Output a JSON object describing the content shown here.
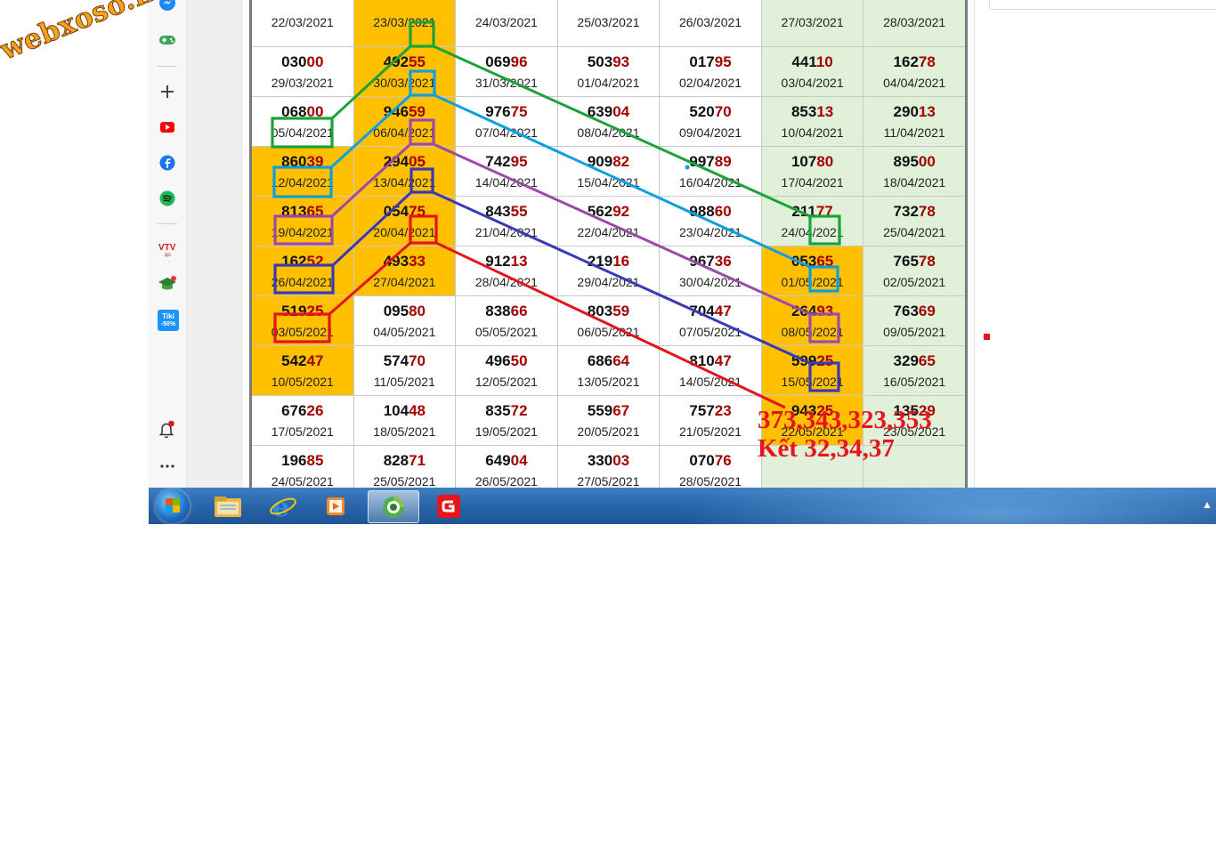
{
  "watermark": "webxoso.net",
  "results": {
    "rows": [
      {
        "cells": [
          {
            "num": "",
            "date": "22/03/2021"
          },
          {
            "num": "",
            "date": "23/03/2021"
          },
          {
            "num": "",
            "date": "24/03/2021"
          },
          {
            "num": "",
            "date": "25/03/2021"
          },
          {
            "num": "",
            "date": "26/03/2021"
          },
          {
            "num": "",
            "date": "27/03/2021"
          },
          {
            "num": "",
            "date": "28/03/2021"
          }
        ]
      },
      {
        "cells": [
          {
            "num": "03000",
            "date": "29/03/2021"
          },
          {
            "num": "49255",
            "date": "30/03/2021"
          },
          {
            "num": "06996",
            "date": "31/03/2021"
          },
          {
            "num": "50393",
            "date": "01/04/2021"
          },
          {
            "num": "01795",
            "date": "02/04/2021"
          },
          {
            "num": "44110",
            "date": "03/04/2021"
          },
          {
            "num": "16278",
            "date": "04/04/2021"
          }
        ]
      },
      {
        "cells": [
          {
            "num": "06800",
            "date": "05/04/2021"
          },
          {
            "num": "94659",
            "date": "06/04/2021"
          },
          {
            "num": "97675",
            "date": "07/04/2021"
          },
          {
            "num": "63904",
            "date": "08/04/2021"
          },
          {
            "num": "52070",
            "date": "09/04/2021"
          },
          {
            "num": "85313",
            "date": "10/04/2021"
          },
          {
            "num": "29013",
            "date": "11/04/2021"
          }
        ]
      },
      {
        "cells": [
          {
            "num": "86039",
            "date": "12/04/2021"
          },
          {
            "num": "29405",
            "date": "13/04/2021"
          },
          {
            "num": "74295",
            "date": "14/04/2021"
          },
          {
            "num": "90982",
            "date": "15/04/2021"
          },
          {
            "num": "99789",
            "date": "16/04/2021"
          },
          {
            "num": "10780",
            "date": "17/04/2021"
          },
          {
            "num": "89500",
            "date": "18/04/2021"
          }
        ]
      },
      {
        "cells": [
          {
            "num": "81365",
            "date": "19/04/2021"
          },
          {
            "num": "05475",
            "date": "20/04/2021"
          },
          {
            "num": "84355",
            "date": "21/04/2021"
          },
          {
            "num": "56292",
            "date": "22/04/2021"
          },
          {
            "num": "98860",
            "date": "23/04/2021"
          },
          {
            "num": "21177",
            "date": "24/04/2021"
          },
          {
            "num": "73278",
            "date": "25/04/2021"
          }
        ]
      },
      {
        "cells": [
          {
            "num": "16252",
            "date": "26/04/2021"
          },
          {
            "num": "49333",
            "date": "27/04/2021"
          },
          {
            "num": "91213",
            "date": "28/04/2021"
          },
          {
            "num": "21916",
            "date": "29/04/2021"
          },
          {
            "num": "96736",
            "date": "30/04/2021"
          },
          {
            "num": "05365",
            "date": "01/05/2021"
          },
          {
            "num": "76578",
            "date": "02/05/2021"
          }
        ]
      },
      {
        "cells": [
          {
            "num": "51925",
            "date": "03/05/2021"
          },
          {
            "num": "09580",
            "date": "04/05/2021"
          },
          {
            "num": "83866",
            "date": "05/05/2021"
          },
          {
            "num": "80359",
            "date": "06/05/2021"
          },
          {
            "num": "70447",
            "date": "07/05/2021"
          },
          {
            "num": "26493",
            "date": "08/05/2021"
          },
          {
            "num": "76369",
            "date": "09/05/2021"
          }
        ]
      },
      {
        "cells": [
          {
            "num": "54247",
            "date": "10/05/2021"
          },
          {
            "num": "57470",
            "date": "11/05/2021"
          },
          {
            "num": "49650",
            "date": "12/05/2021"
          },
          {
            "num": "68664",
            "date": "13/05/2021"
          },
          {
            "num": "81047",
            "date": "14/05/2021"
          },
          {
            "num": "59925",
            "date": "15/05/2021"
          },
          {
            "num": "32965",
            "date": "16/05/2021"
          }
        ]
      },
      {
        "cells": [
          {
            "num": "67626",
            "date": "17/05/2021"
          },
          {
            "num": "10448",
            "date": "18/05/2021"
          },
          {
            "num": "83572",
            "date": "19/05/2021"
          },
          {
            "num": "55967",
            "date": "20/05/2021"
          },
          {
            "num": "75723",
            "date": "21/05/2021"
          },
          {
            "num": "94325",
            "date": "22/05/2021"
          },
          {
            "num": "13529",
            "date": "23/05/2021"
          }
        ]
      },
      {
        "cells": [
          {
            "num": "19685",
            "date": "24/05/2021"
          },
          {
            "num": "82871",
            "date": "25/05/2021"
          },
          {
            "num": "64904",
            "date": "26/05/2021"
          },
          {
            "num": "33003",
            "date": "27/05/2021"
          },
          {
            "num": "07076",
            "date": "28/05/2021"
          },
          {
            "num": "",
            "date": ""
          },
          {
            "num": "",
            "date": ""
          }
        ]
      }
    ]
  },
  "annotation": {
    "line1": "373,343,323,353",
    "line2": "Kết 32,34,37"
  },
  "sidebar": {
    "icons": [
      "messenger-icon",
      "games-icon",
      "add-icon",
      "youtube-icon",
      "facebook-icon",
      "spotify-icon",
      "vtv-go-icon",
      "graduation-cap-icon",
      "tiki-icon",
      "bell-icon",
      "more-icon"
    ],
    "tiki_badge": "Tiki",
    "tiki_discount": "-50%"
  },
  "taskbar": {
    "apps": [
      "windows-start-icon",
      "file-explorer-icon",
      "internet-explorer-icon",
      "media-player-icon",
      "coccoc-browser-icon",
      "garena-icon"
    ]
  },
  "colors": {
    "highlight_yellow": "#ffc000",
    "weekend_green": "#e1f0d9",
    "tail_red": "#a40000",
    "line_green": "#1aa33a",
    "line_cyan": "#0aa0e0",
    "line_purple": "#9b4aa8",
    "line_blue": "#3a3ab8",
    "line_red": "#e3141c"
  }
}
